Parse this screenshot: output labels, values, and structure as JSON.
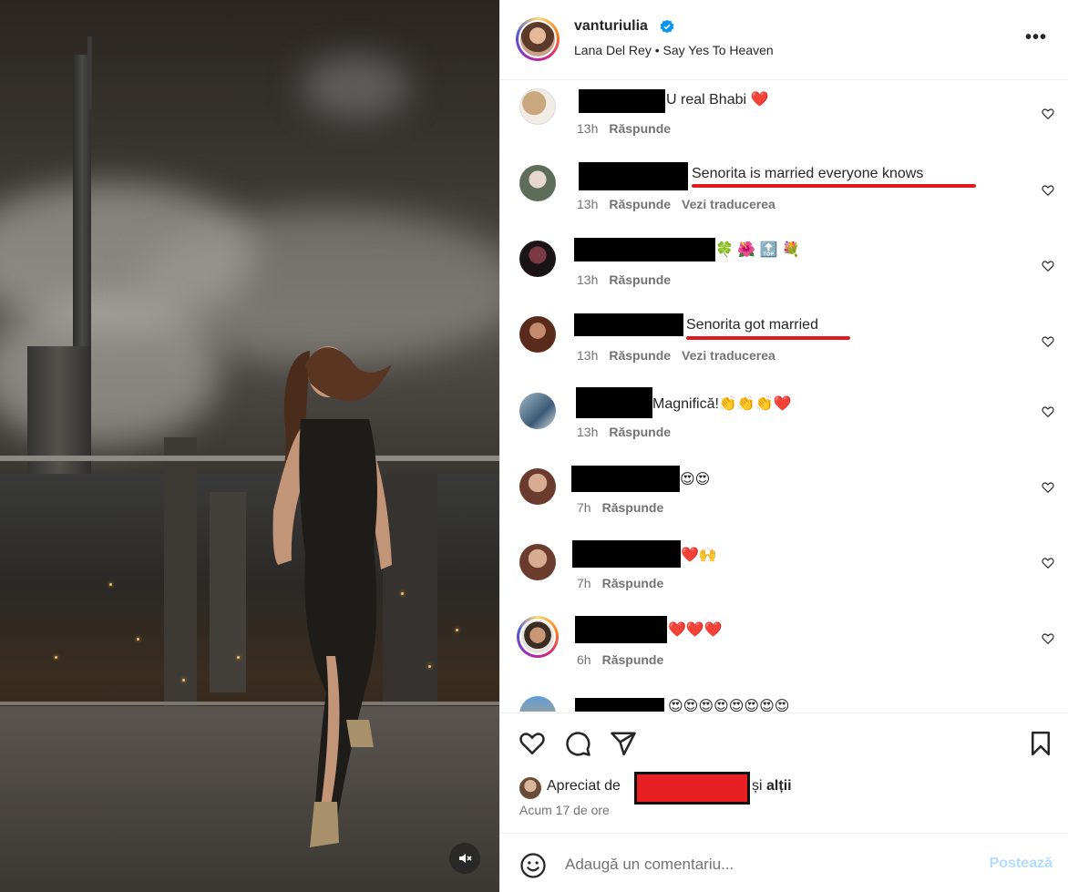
{
  "post": {
    "username": "vanturiulia",
    "verified": true,
    "song": "Lana Del Rey • Say Yes To Heaven",
    "more_icon": "more-horizontal-icon"
  },
  "comments": [
    {
      "text": "U real Bhabi ❤️",
      "time": "13h",
      "reply": "Răspunde",
      "translate": ""
    },
    {
      "text": "Senorita is married everyone knows",
      "time": "13h",
      "reply": "Răspunde",
      "translate": "Vezi traducerea"
    },
    {
      "text": "🍀 🌺 🔝 💐",
      "time": "13h",
      "reply": "Răspunde",
      "translate": ""
    },
    {
      "text": "Senorita got married",
      "time": "13h",
      "reply": "Răspunde",
      "translate": "Vezi traducerea"
    },
    {
      "text": "Magnifică!👏👏👏❤️",
      "time": "13h",
      "reply": "Răspunde",
      "translate": ""
    },
    {
      "text": "😍😍",
      "time": "7h",
      "reply": "Răspunde",
      "translate": ""
    },
    {
      "text": "❤️🙌",
      "time": "7h",
      "reply": "Răspunde",
      "translate": ""
    },
    {
      "text": "❤️❤️❤️",
      "time": "6h",
      "reply": "Răspunde",
      "translate": ""
    },
    {
      "text": "😍😍😍😍😍😍😍😍",
      "time": "",
      "reply": "",
      "translate": ""
    }
  ],
  "actions": {
    "liked_prefix": "Apreciat de",
    "liked_suffix": "și",
    "liked_others": "alții",
    "time_ago": "Acum 17 de ore"
  },
  "composer": {
    "placeholder": "Adaugă un comentariu...",
    "post_label": "Postează"
  },
  "colors": {
    "annotation_red": "#e0191e",
    "post_disabled": "#b3dbff",
    "verified_blue": "#0095f6"
  }
}
